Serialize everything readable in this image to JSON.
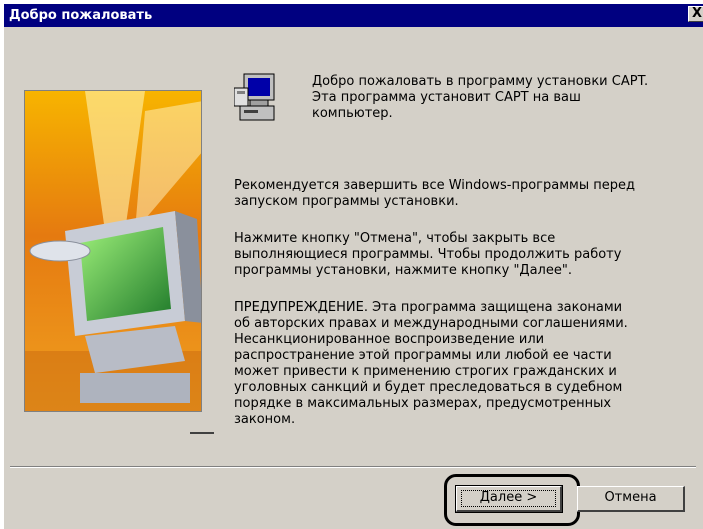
{
  "window": {
    "title": "Добро пожаловать",
    "close_label": "X"
  },
  "content": {
    "welcome_lines": [
      "Добро пожаловать в программу установки CAPT.",
      "Эта программа установит CAPT на ваш",
      "компьютер."
    ],
    "recommend_lines": [
      "Рекомендуется завершить все Windows-программы перед",
      "запуском программы установки."
    ],
    "cancel_info_lines": [
      "Нажмите кнопку \"Отмена\", чтобы закрыть все",
      "выполняющиеся программы. Чтобы продолжить работу",
      "программы установки, нажмите кнопку \"Далее\"."
    ],
    "warning_lines": [
      "ПРЕДУПРЕЖДЕНИЕ. Эта программа защищена законами",
      "об авторских правах и международными соглашениями.",
      "Несанкционированное воспроизведение или",
      "распространение этой программы или любой ее части",
      "может привести к применению строгих гражданских и",
      "уголовных санкций и будет преследоваться в судебном",
      "порядке в максимальных размерах, предусмотренных",
      "законом."
    ]
  },
  "buttons": {
    "next_label": "Далее >",
    "cancel_label": "Отмена"
  },
  "icons": {
    "setup": "computer-setup-icon",
    "close": "close-icon"
  },
  "colors": {
    "titlebar": "#000080",
    "dialog_bg": "#d4d0c8"
  }
}
